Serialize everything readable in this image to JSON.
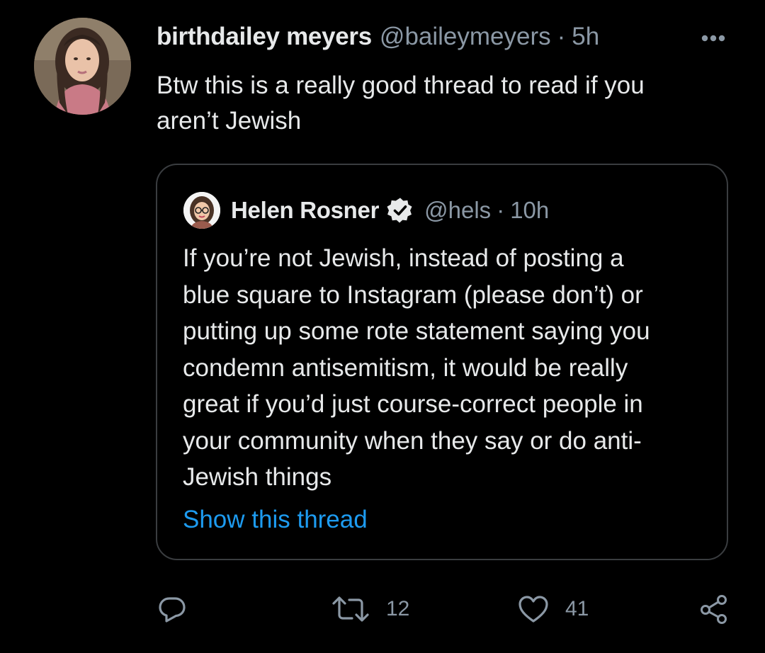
{
  "tweet": {
    "display_name": "birthdailey meyers",
    "handle": "@baileymeyers",
    "separator": "·",
    "time": "5h",
    "text": "Btw this is a really good thread to read if you\naren’t Jewish",
    "more_icon": "more-horizontal-icon"
  },
  "quote": {
    "display_name": "Helen Rosner",
    "verified_icon": "verified-badge-icon",
    "handle": "@hels",
    "separator": "·",
    "time": "10h",
    "text": "If you’re not Jewish, instead of posting a\nblue square to Instagram (please don’t) or\nputting up some rote statement saying you\ncondemn antisemitism, it would be really\ngreat if you’d just course-correct people in\nyour community when they say or do anti-\nJewish things",
    "show_thread": "Show this thread"
  },
  "actions": {
    "reply_icon": "reply-icon",
    "retweet_icon": "retweet-icon",
    "retweet_count": "12",
    "like_icon": "heart-icon",
    "like_count": "41",
    "share_icon": "share-icon"
  },
  "colors": {
    "background": "#000000",
    "text_primary": "#e7e9ea",
    "text_secondary": "#8b98a5",
    "link": "#1d9bf0",
    "border": "#3a3d40"
  }
}
